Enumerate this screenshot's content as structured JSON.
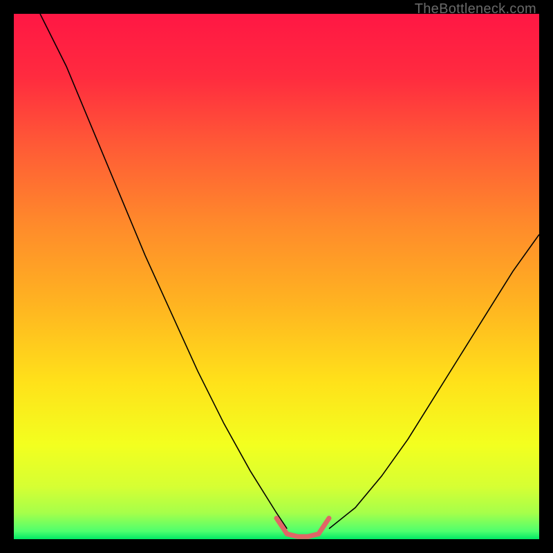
{
  "watermark": {
    "text": "TheBottleneck.com"
  },
  "chart_data": {
    "type": "line",
    "title": "",
    "xlabel": "",
    "ylabel": "",
    "xlim": [
      0,
      100
    ],
    "ylim": [
      0,
      100
    ],
    "grid": false,
    "legend": false,
    "background_gradient_stops": [
      {
        "offset": 0.0,
        "color": "#ff1744"
      },
      {
        "offset": 0.12,
        "color": "#ff2b3f"
      },
      {
        "offset": 0.25,
        "color": "#ff5a36"
      },
      {
        "offset": 0.4,
        "color": "#ff8a2b"
      },
      {
        "offset": 0.55,
        "color": "#ffb321"
      },
      {
        "offset": 0.7,
        "color": "#ffe11a"
      },
      {
        "offset": 0.82,
        "color": "#f3ff1f"
      },
      {
        "offset": 0.9,
        "color": "#d6ff33"
      },
      {
        "offset": 0.95,
        "color": "#a6ff4a"
      },
      {
        "offset": 0.985,
        "color": "#4eff6e"
      },
      {
        "offset": 1.0,
        "color": "#00e865"
      }
    ],
    "series": [
      {
        "name": "left-branch",
        "color": "#000000",
        "width": 1.6,
        "x": [
          5,
          10,
          15,
          20,
          25,
          30,
          35,
          40,
          45,
          50,
          52
        ],
        "y": [
          100,
          90,
          78,
          66,
          54,
          43,
          32,
          22,
          13,
          5,
          2
        ]
      },
      {
        "name": "right-branch",
        "color": "#000000",
        "width": 1.6,
        "x": [
          60,
          65,
          70,
          75,
          80,
          85,
          90,
          95,
          100
        ],
        "y": [
          2,
          6,
          12,
          19,
          27,
          35,
          43,
          51,
          58
        ]
      },
      {
        "name": "bottom-marker",
        "color": "#e06666",
        "width": 7,
        "linecap": "round",
        "x": [
          50,
          52,
          54,
          56,
          58,
          60
        ],
        "y": [
          4,
          1,
          0.5,
          0.5,
          1,
          4
        ]
      }
    ]
  }
}
